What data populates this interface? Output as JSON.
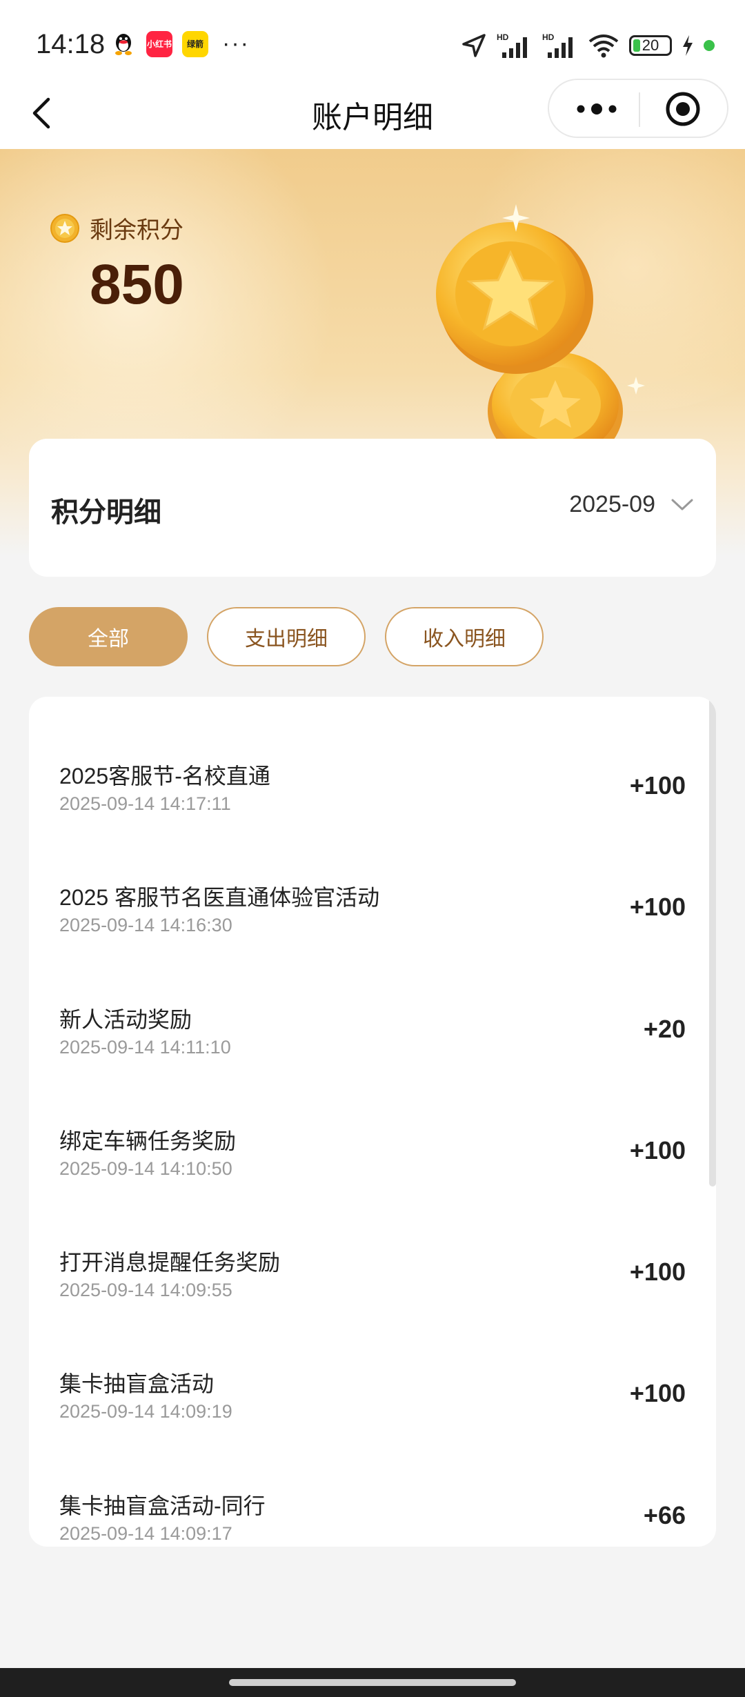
{
  "status_bar": {
    "time": "14:18",
    "app_icons": [
      "qq-icon",
      "xiaohongshu-icon",
      "yellow-app-icon"
    ],
    "xhs_label": "小红书",
    "yellow_label": "绿箭",
    "more": "···",
    "battery": "20",
    "network": "HD"
  },
  "nav": {
    "title": "账户明细",
    "back_icon": "chevron-left-icon",
    "more_icon": "more-dots-icon",
    "close_icon": "target-icon"
  },
  "points": {
    "label": "剩余积分",
    "value": "850",
    "icon": "star-coin-icon"
  },
  "detail": {
    "title": "积分明细",
    "month": "2025-09",
    "dropdown_icon": "chevron-down-icon"
  },
  "tabs": [
    {
      "label": "全部",
      "active": true
    },
    {
      "label": "支出明细",
      "active": false
    },
    {
      "label": "收入明细",
      "active": false
    }
  ],
  "records": [
    {
      "title": "2025客服节-名校直通",
      "time": "2025-09-14 14:17:11",
      "amount": "+100"
    },
    {
      "title": "2025 客服节名医直通体验官活动",
      "time": "2025-09-14 14:16:30",
      "amount": "+100"
    },
    {
      "title": "新人活动奖励",
      "time": "2025-09-14 14:11:10",
      "amount": "+20"
    },
    {
      "title": "绑定车辆任务奖励",
      "time": "2025-09-14 14:10:50",
      "amount": "+100"
    },
    {
      "title": "打开消息提醒任务奖励",
      "time": "2025-09-14 14:09:55",
      "amount": "+100"
    },
    {
      "title": "集卡抽盲盒活动",
      "time": "2025-09-14 14:09:19",
      "amount": "+100"
    },
    {
      "title": "集卡抽盲盒活动-同行",
      "time": "2025-09-14 14:09:17",
      "amount": "+66"
    }
  ],
  "colors": {
    "accent": "#d4a466",
    "accent_text": "#8a5520",
    "points_value": "#4a1f08",
    "hero_top": "#f1cc8c"
  }
}
